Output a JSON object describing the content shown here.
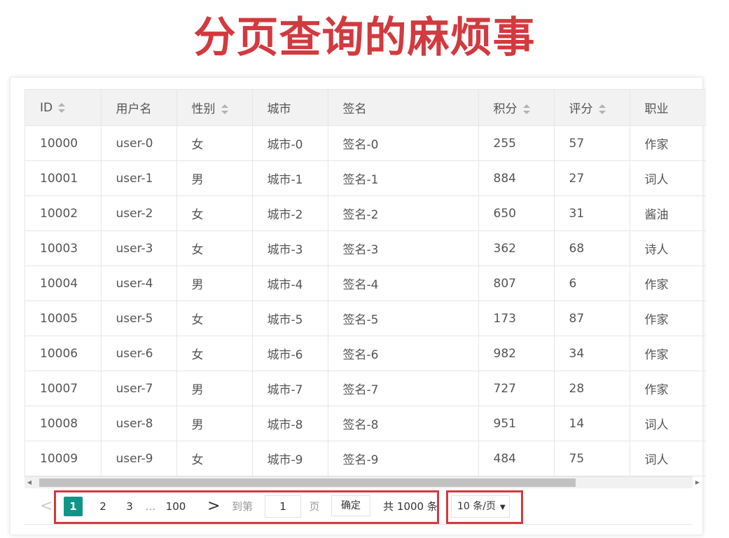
{
  "headline": "分页查询的麻烦事",
  "colors": {
    "headline": "#d23a3f",
    "accent": "#0f9688",
    "highlight": "#d23a3f"
  },
  "table": {
    "columns": [
      {
        "label": "ID",
        "sortable": true
      },
      {
        "label": "用户名",
        "sortable": false
      },
      {
        "label": "性别",
        "sortable": true
      },
      {
        "label": "城市",
        "sortable": false
      },
      {
        "label": "签名",
        "sortable": false
      },
      {
        "label": "积分",
        "sortable": true
      },
      {
        "label": "评分",
        "sortable": true
      },
      {
        "label": "职业",
        "sortable": false
      }
    ],
    "rows": [
      [
        "10000",
        "user-0",
        "女",
        "城市-0",
        "签名-0",
        "255",
        "57",
        "作家"
      ],
      [
        "10001",
        "user-1",
        "男",
        "城市-1",
        "签名-1",
        "884",
        "27",
        "词人"
      ],
      [
        "10002",
        "user-2",
        "女",
        "城市-2",
        "签名-2",
        "650",
        "31",
        "酱油"
      ],
      [
        "10003",
        "user-3",
        "女",
        "城市-3",
        "签名-3",
        "362",
        "68",
        "诗人"
      ],
      [
        "10004",
        "user-4",
        "男",
        "城市-4",
        "签名-4",
        "807",
        "6",
        "作家"
      ],
      [
        "10005",
        "user-5",
        "女",
        "城市-5",
        "签名-5",
        "173",
        "87",
        "作家"
      ],
      [
        "10006",
        "user-6",
        "女",
        "城市-6",
        "签名-6",
        "982",
        "34",
        "作家"
      ],
      [
        "10007",
        "user-7",
        "男",
        "城市-7",
        "签名-7",
        "727",
        "28",
        "作家"
      ],
      [
        "10008",
        "user-8",
        "男",
        "城市-8",
        "签名-8",
        "951",
        "14",
        "词人"
      ],
      [
        "10009",
        "user-9",
        "女",
        "城市-9",
        "签名-9",
        "484",
        "75",
        "词人"
      ]
    ]
  },
  "pager": {
    "prev": "<",
    "current_page": "1",
    "page_2": "2",
    "page_3": "3",
    "ellipsis": "…",
    "last_page": "100",
    "next": ">",
    "goto_label": "到第",
    "goto_value": "1",
    "page_unit": "页",
    "confirm_label": "确定",
    "total_label": "共 1000 条",
    "page_size_label": "10 条/页"
  }
}
